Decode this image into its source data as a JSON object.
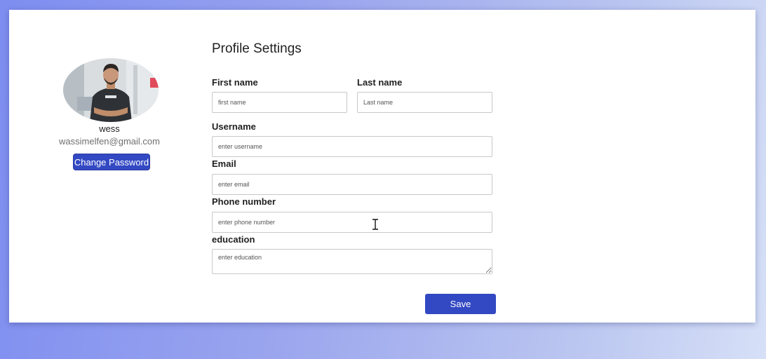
{
  "profile": {
    "avatar_icon": "user-photo",
    "name": "wess",
    "email": "wassimelfen@gmail.com",
    "change_password_label": "Change Password"
  },
  "form": {
    "title": "Profile Settings",
    "first_name": {
      "label": "First name",
      "placeholder": "first name",
      "value": ""
    },
    "last_name": {
      "label": "Last name",
      "placeholder": "Last name",
      "value": ""
    },
    "username": {
      "label": "Username",
      "placeholder": "enter username",
      "value": ""
    },
    "email": {
      "label": "Email",
      "placeholder": "enter email",
      "value": ""
    },
    "phone": {
      "label": "Phone number",
      "placeholder": "enter phone number",
      "value": ""
    },
    "education": {
      "label": "education",
      "placeholder": "enter education",
      "value": ""
    },
    "save_label": "Save"
  },
  "colors": {
    "accent": "#3349c3",
    "card": "#ffffff",
    "input_border": "#c8c8c8"
  },
  "cursor_icon": "text-cursor-icon"
}
